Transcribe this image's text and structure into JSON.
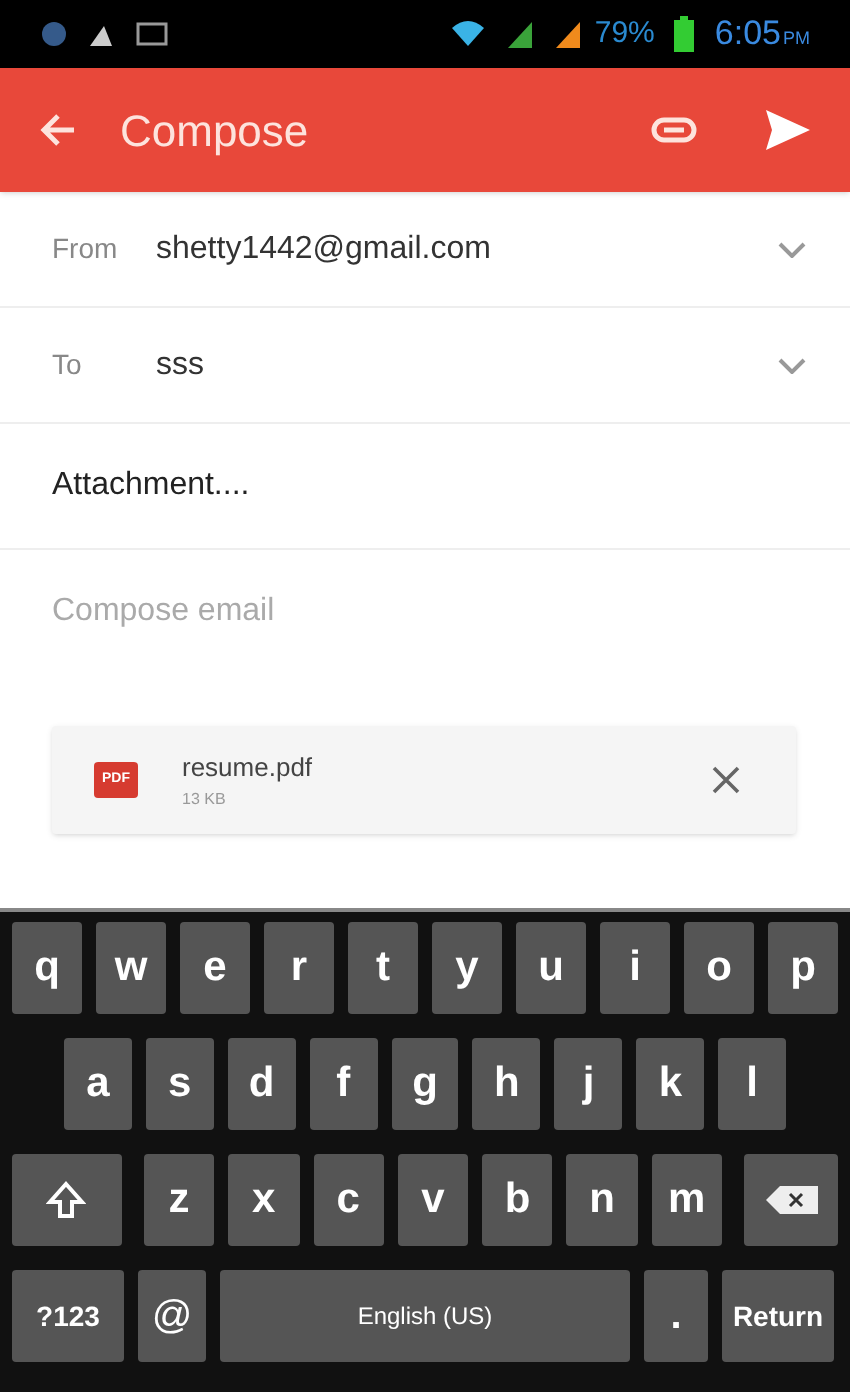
{
  "status_bar": {
    "battery": "79%",
    "time": "6:05",
    "time_suffix": "PM"
  },
  "app_bar": {
    "title": "Compose"
  },
  "fields": [
    {
      "label": "From",
      "value": "shetty1442@gmail.com"
    },
    {
      "label": "To",
      "value": "sss"
    }
  ],
  "subject": {
    "value": "Attachment...."
  },
  "body": {
    "placeholder": "Compose email"
  },
  "attachment": {
    "name": "resume.pdf",
    "size": "13 KB",
    "badge": "PDF"
  },
  "keyboard": {
    "rows": [
      [
        {
          "kind": "char",
          "label": "q"
        },
        {
          "kind": "char",
          "label": "w"
        },
        {
          "kind": "char",
          "label": "e"
        },
        {
          "kind": "char",
          "label": "r"
        },
        {
          "kind": "char",
          "label": "t"
        },
        {
          "kind": "char",
          "label": "y"
        },
        {
          "kind": "char",
          "label": "u"
        },
        {
          "kind": "char",
          "label": "i"
        },
        {
          "kind": "char",
          "label": "o"
        },
        {
          "kind": "char",
          "label": "p"
        }
      ],
      [
        {
          "kind": "char",
          "label": "a"
        },
        {
          "kind": "char",
          "label": "s"
        },
        {
          "kind": "char",
          "label": "d"
        },
        {
          "kind": "char",
          "label": "f"
        },
        {
          "kind": "char",
          "label": "g"
        },
        {
          "kind": "char",
          "label": "h"
        },
        {
          "kind": "char",
          "label": "j"
        },
        {
          "kind": "char",
          "label": "k"
        },
        {
          "kind": "char",
          "label": "l"
        }
      ],
      [
        {
          "kind": "shift"
        },
        {
          "kind": "char",
          "label": "z"
        },
        {
          "kind": "char",
          "label": "x"
        },
        {
          "kind": "char",
          "label": "c"
        },
        {
          "kind": "char",
          "label": "v"
        },
        {
          "kind": "char",
          "label": "b"
        },
        {
          "kind": "char",
          "label": "n"
        },
        {
          "kind": "char",
          "label": "m"
        },
        {
          "kind": "backspace"
        }
      ]
    ],
    "bottom_row": {
      "symbols": "?123",
      "at": "@",
      "space": "English (US)",
      "period": ".",
      "return": "Return"
    }
  }
}
